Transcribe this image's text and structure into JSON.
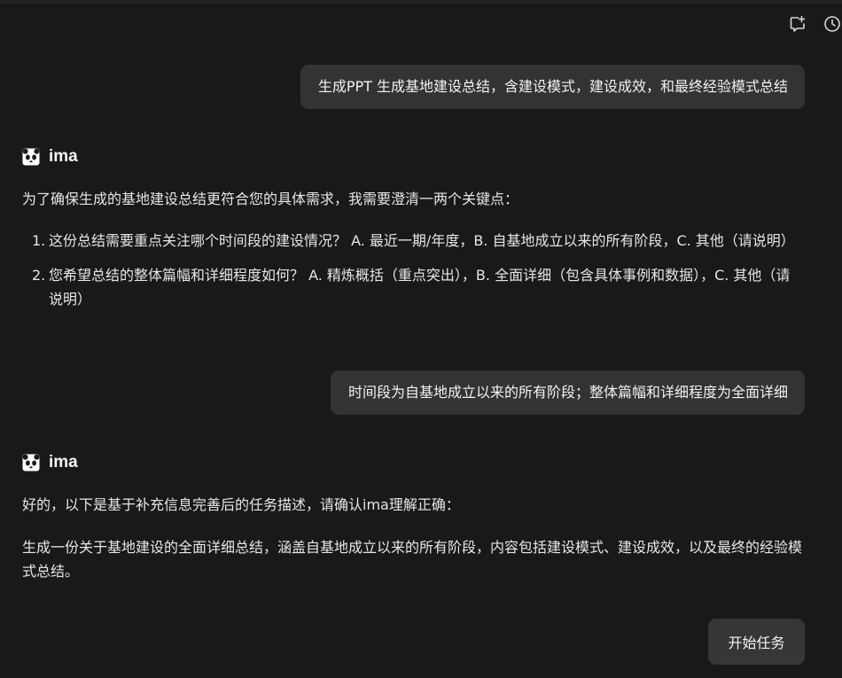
{
  "toolbar": {
    "icons": [
      "add-note-icon",
      "history-clock-icon"
    ]
  },
  "colors": {
    "background": "#191919",
    "bubble": "#333333",
    "text": "#e6e6e6"
  },
  "conversation": {
    "user_msg_1": "生成PPT  生成基地建设总结，含建设模式，建设成效，和最终经验模式总结",
    "ai_name_1": "ima",
    "ai_intro_1": "为了确保生成的基地建设总结更符合您的具体需求，我需要澄清一两个关键点：",
    "questions": [
      {
        "num": "1.",
        "text": "这份总结需要重点关注哪个时间段的建设情况？ A. 最近一期/年度，B. 自基地成立以来的所有阶段，C. 其他（请说明）"
      },
      {
        "num": "2.",
        "text": "您希望总结的整体篇幅和详细程度如何？ A. 精炼概括（重点突出），B. 全面详细（包含具体事例和数据），C. 其他（请说明）"
      }
    ],
    "user_msg_2": "时间段为自基地成立以来的所有阶段；整体篇幅和详细程度为全面详细",
    "ai_name_2": "ima",
    "ai_reply_line1": "好的，以下是基于补充信息完善后的任务描述，请确认ima理解正确：",
    "ai_reply_line2": "生成一份关于基地建设的全面详细总结，涵盖自基地成立以来的所有阶段，内容包括建设模式、建设成效，以及最终的经验模式总结。",
    "start_button": "开始任务"
  }
}
